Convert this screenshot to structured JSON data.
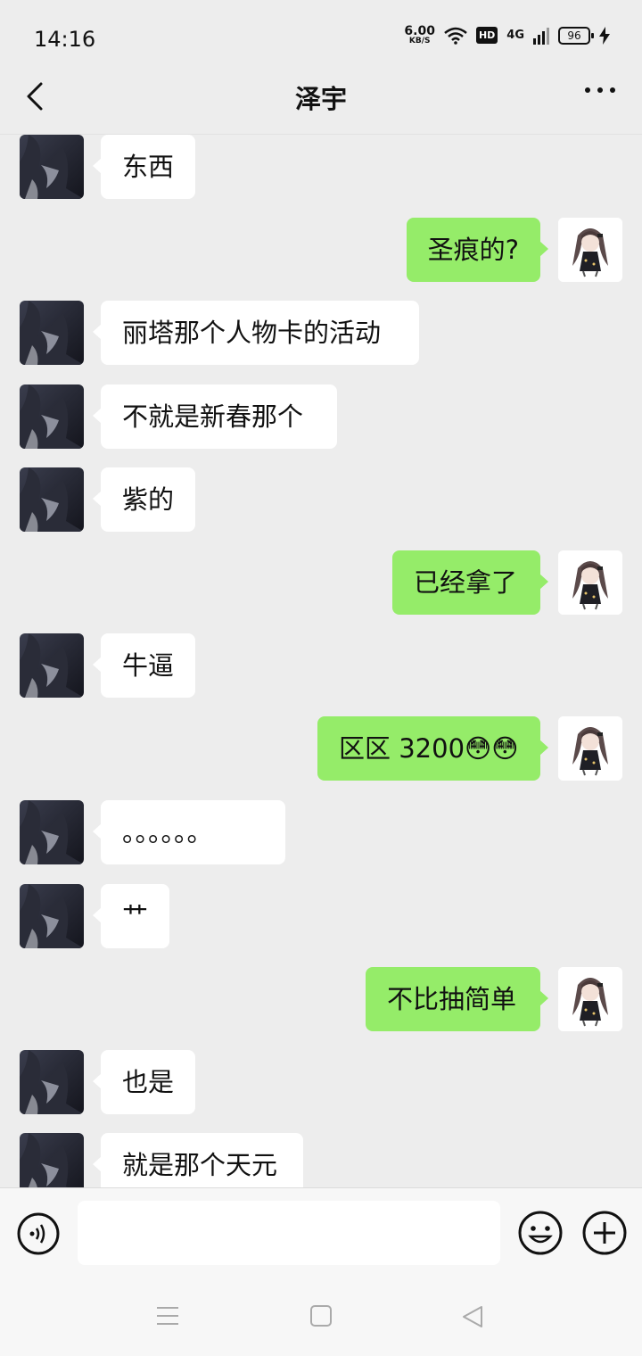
{
  "status_bar": {
    "time": "14:16",
    "net_speed_value": "6.00",
    "net_speed_unit": "KB/S",
    "hd_label": "HD",
    "signal_label": "4G",
    "battery": "96"
  },
  "header": {
    "title": "泽宇"
  },
  "messages": [
    {
      "side": "left",
      "text": "东西"
    },
    {
      "side": "right",
      "text": "圣痕的?"
    },
    {
      "side": "left",
      "text": "丽塔那个人物卡的活动"
    },
    {
      "side": "left",
      "text": "不就是新春那个"
    },
    {
      "side": "left",
      "text": "紫的"
    },
    {
      "side": "right",
      "text": "已经拿了"
    },
    {
      "side": "left",
      "text": "牛逼"
    },
    {
      "side": "right",
      "text": "区区 3200😳😳"
    },
    {
      "side": "left",
      "text": "。。。。。。"
    },
    {
      "side": "left",
      "text": "艹"
    },
    {
      "side": "right",
      "text": "不比抽简单"
    },
    {
      "side": "left",
      "text": "也是"
    },
    {
      "side": "left",
      "text": "就是那个天元"
    }
  ],
  "input": {
    "value": "",
    "placeholder": ""
  },
  "icons": {
    "back": "chevron-left-icon",
    "more": "more-dots-icon",
    "voice": "voice-icon",
    "emoji": "emoji-icon",
    "plus": "plus-icon"
  },
  "colors": {
    "background": "#ededed",
    "bubble_self": "#95ec69",
    "bubble_other": "#ffffff"
  }
}
